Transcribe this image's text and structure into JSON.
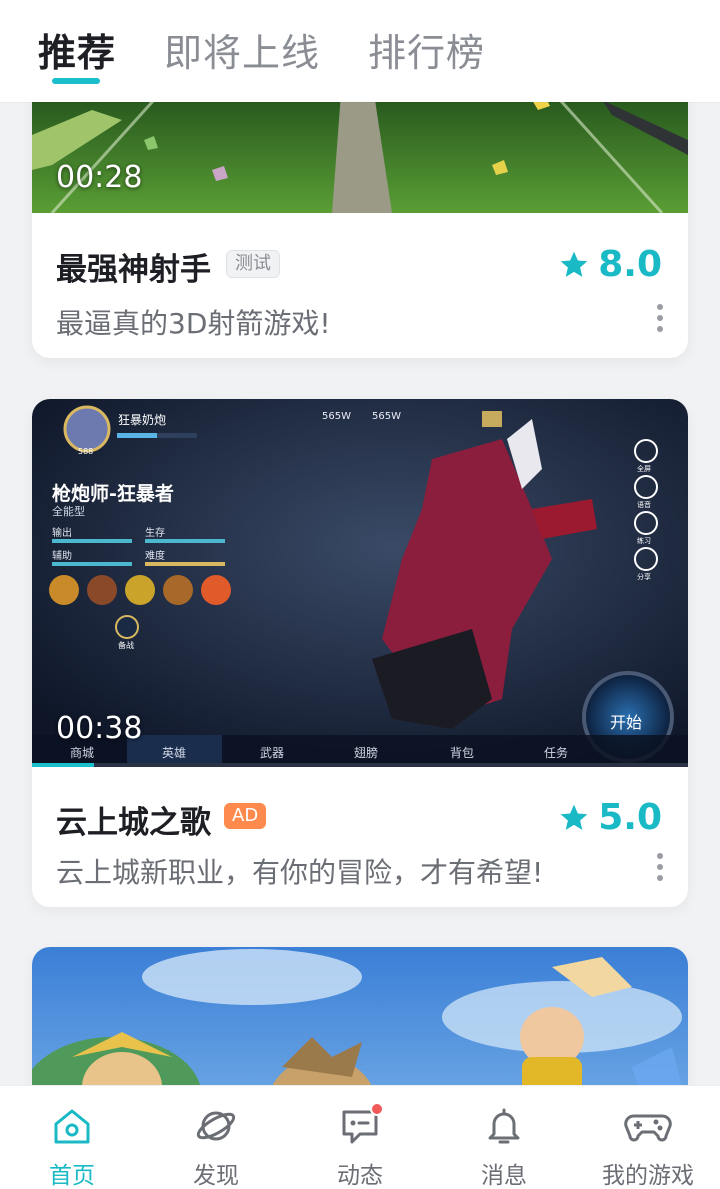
{
  "tabs": [
    "推荐",
    "即将上线",
    "排行榜"
  ],
  "cards": [
    {
      "duration": "00:28",
      "title": "最强神射手",
      "tag": "测试",
      "rating": "8.0",
      "description": "最逼真的3D射箭游戏!"
    },
    {
      "duration": "00:38",
      "title": "云上城之歌",
      "tag": "AD",
      "rating": "5.0",
      "description": "云上城新职业，有你的冒险，才有希望!",
      "game_ui": {
        "player_name": "狂暴奶炮",
        "level": "588",
        "currency_1": "565W",
        "currency_2": "565W",
        "class_name": "枪炮师-狂暴者",
        "class_type": "全能型",
        "stats": [
          "输出",
          "生存",
          "辅助",
          "难度"
        ],
        "side_buttons": [
          "全屏",
          "语音",
          "练习",
          "分享"
        ],
        "bottom_tabs": [
          "商城",
          "英雄",
          "武器",
          "翅膀",
          "背包",
          "任务"
        ],
        "start_button": "开始",
        "prep_label": "备战"
      }
    },
    {}
  ],
  "nav": [
    {
      "label": "首页",
      "icon": "home-icon"
    },
    {
      "label": "发现",
      "icon": "planet-icon"
    },
    {
      "label": "动态",
      "icon": "message-icon"
    },
    {
      "label": "消息",
      "icon": "bell-icon"
    },
    {
      "label": "我的游戏",
      "icon": "gamepad-icon"
    }
  ],
  "colors": {
    "accent": "#19c0cc",
    "ad_tag": "#ff8a4d",
    "notification": "#f25a5a"
  }
}
